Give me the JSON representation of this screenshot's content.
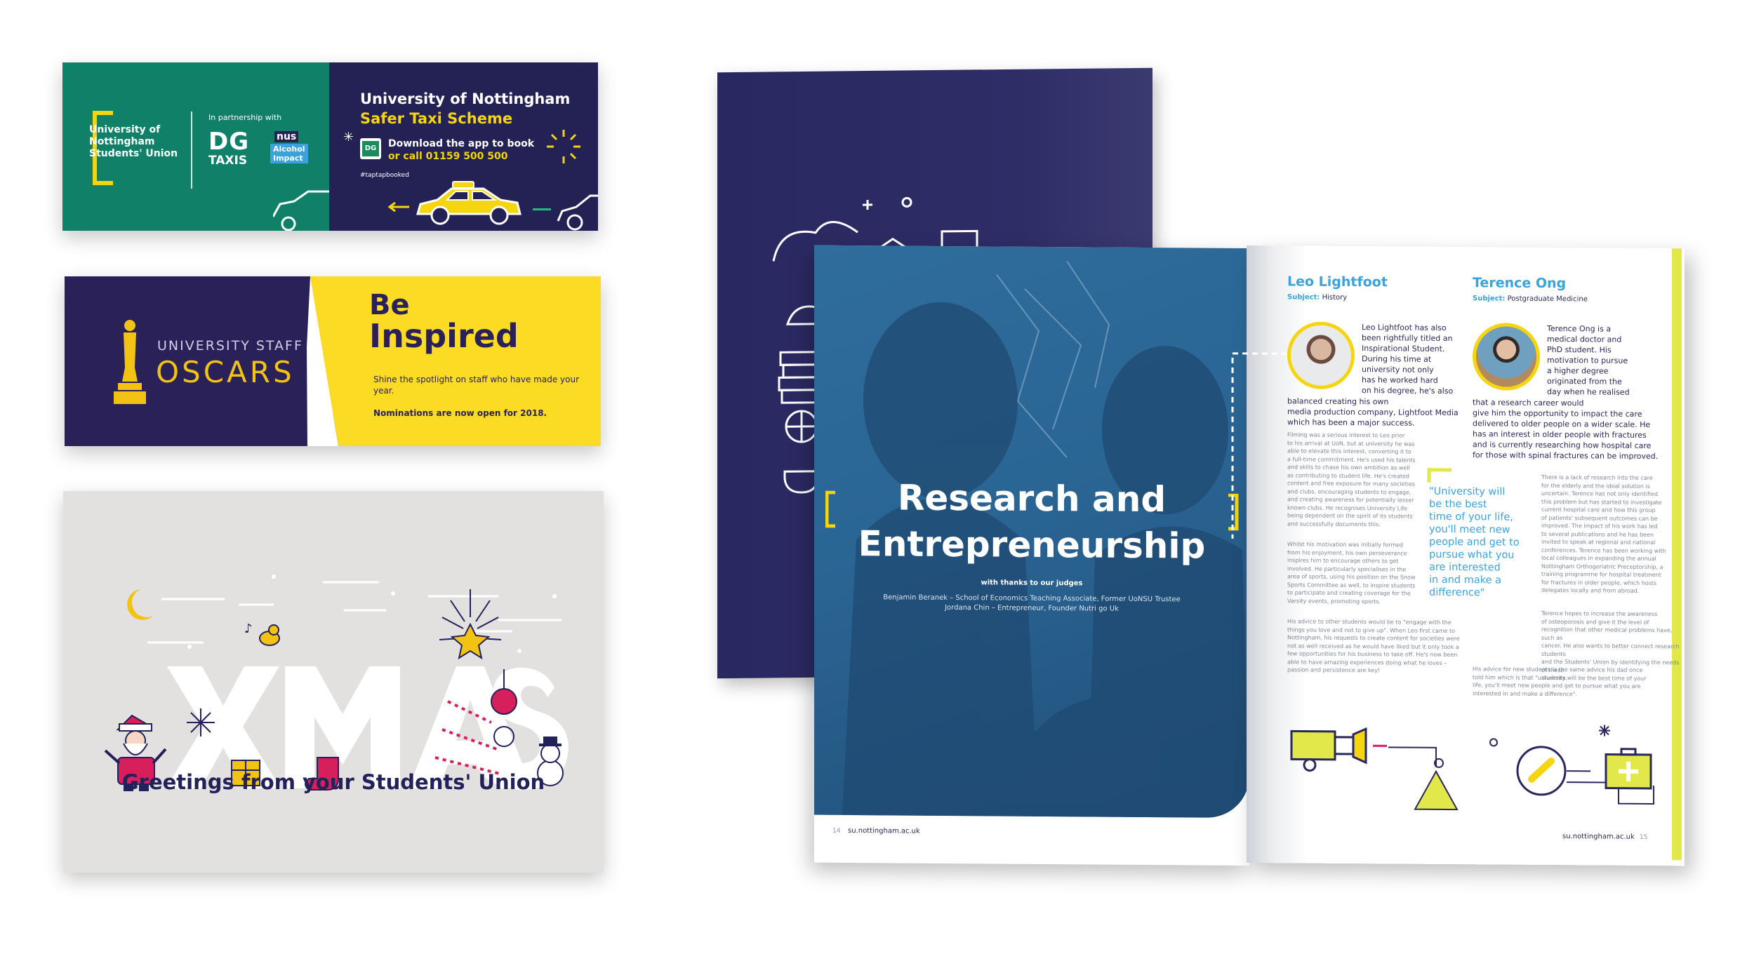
{
  "taxi_banner": {
    "union_name_line1": "University of",
    "union_name_line2": "Nottingham",
    "union_name_line3": "Students' Union",
    "partnership": "In partnership with",
    "dg_logo": "DG",
    "dg_taxis": "TAXIS",
    "nus_logo": "nus",
    "alcohol": "Alcohol",
    "impact": "Impact",
    "title": "University of Nottingham",
    "subtitle": "Safer Taxi Scheme",
    "download": "Download the app to book",
    "call": "or call 01159 500 500",
    "hashtag": "#taptapbooked",
    "colors": {
      "green": "#118069",
      "navy": "#242154",
      "yellow": "#f5d410"
    }
  },
  "oscars_banner": {
    "small_title": "UNIVERSITY STAFF",
    "big_title": "OSCARS",
    "be": "Be",
    "inspired": "Inspired",
    "body": "Shine the spotlight on staff who have made your",
    "body2": "year.",
    "nominations": "Nominations are now open for 2018.",
    "colors": {
      "yellow": "#fbdb24",
      "navy": "#2a2158"
    }
  },
  "xmas_card": {
    "letters": "XMAS",
    "greeting": "Greetings from your Students' Union",
    "colors": {
      "bg": "#e3e1e0",
      "navy": "#23215a",
      "red": "#d61f5b",
      "gold": "#f2c312"
    }
  },
  "magazine": {
    "cover_title_line1": "Research and",
    "cover_title_line2": "Entrepreneurship",
    "thanks": "with thanks to our judges",
    "judge1": "Benjamin Beranek – School of Economics Teaching Associate, Former UoNSU Trustee",
    "judge2": "Jordana Chin – Entrepreneur, Founder Nutri go Uk",
    "left_page_num": "14",
    "left_footer_url": "su.nottingham.ac.uk",
    "right_footer_url": "su.nottingham.ac.uk",
    "right_page_num": "15",
    "person1": {
      "name": "Leo Lightfoot",
      "subject_label": "Subject:",
      "subject": "History",
      "intro": [
        "Leo Lightfoot has also",
        "been rightfully titled an",
        "Inspirational Student.",
        "During his time at",
        "university not only",
        "has he worked hard",
        "on his degree, he's also",
        "balanced creating his own",
        "media production company, Lightfoot Media",
        "which has been a major success."
      ],
      "p1": [
        "Filming was a serious interest to Leo prior",
        "to his arrival at UoN, but at university he was",
        "able to elevate this interest, converting it to",
        "a full-time commitment. He's used his talents",
        "and skills to chase his own ambition as well",
        "as contributing to student life. He's created",
        "content and free exposure for many societies",
        "and clubs, encouraging students to engage,",
        "and creating awareness for potentially lesser",
        "known clubs. He recognises University Life",
        "being dependent on the spirit of its students",
        "and successfully documents this."
      ],
      "p2": [
        "Whilst his motivation was initially formed",
        "from his enjoyment, his own perseverance",
        "inspires him to encourage others to get",
        "involved. He particularly specialises in the",
        "area of sports, using his position on the Snow",
        "Sports Committee as well, to inspire students",
        "to participate and creating coverage for the",
        "Varsity events, promoting sports."
      ],
      "p3": [
        "His advice to other students would be to \"engage with the",
        "things you love and not to give up\". When Leo first came to",
        "Nottingham, his requests to create content for societies were",
        "not as well received as he would have liked but it only took a",
        "few opportunities for his business to take off. He's now been",
        "able to have amazing experiences doing what he loves –",
        "passion and persistence are key!"
      ]
    },
    "quote": [
      "\"University will",
      "be the best",
      "time of your life,",
      "you'll meet new",
      "people and get to",
      "pursue what you",
      "are interested",
      "in and make a",
      "difference\""
    ],
    "person2": {
      "name": "Terence Ong",
      "subject_label": "Subject:",
      "subject": "Postgraduate Medicine",
      "intro": [
        "Terence Ong is a",
        "medical doctor and",
        "PhD student. His",
        "motivation to pursue",
        "a higher degree",
        "originated from the",
        "day when he realised",
        "that a research career would",
        "give him the opportunity to impact the care",
        "delivered to older people on a wider scale. He",
        "has an interest in older people with fractures",
        "and is currently researching how hospital care",
        "for those with spinal fractures can be improved."
      ],
      "p1": [
        "There is a lack of research into the care",
        "for the elderly and the ideal solution is",
        "uncertain.  Terence has not only identified",
        "this problem but has started to investigate",
        "current hospital care and how this group",
        "of patients' subsequent outcomes can be",
        "improved. The impact of his work has led",
        "to several publications and he has been",
        "invited to speak at regional and national",
        "conferences.  Terence has been working with",
        "local colleagues in expanding the annual",
        "Nottingham Orthogeriatric Preceptorship, a",
        "training programme for hospital treatment",
        "for fractures in older people, which hosts",
        "delegates locally and from abroad."
      ],
      "p2": [
        "Terence hopes to increase the awareness",
        "of osteoporosis and give it the level of",
        "recognition that other medical problems have, such as",
        "cancer. He also wants to better connect research students",
        "and the Students' Union by identifying the needs of these",
        "students."
      ],
      "p3": [
        "His advice for new students is the same advice his dad once",
        "told him which is that \"university will be the best time of your",
        "life, you'll meet new people and get to pursue what you are",
        "interested in and make a difference\"."
      ]
    },
    "colors": {
      "navy": "#29275c",
      "blue": "#2f6d9c",
      "accent": "#3aa3dc",
      "lime": "#e3e84a",
      "yellow": "#f5d410"
    }
  }
}
